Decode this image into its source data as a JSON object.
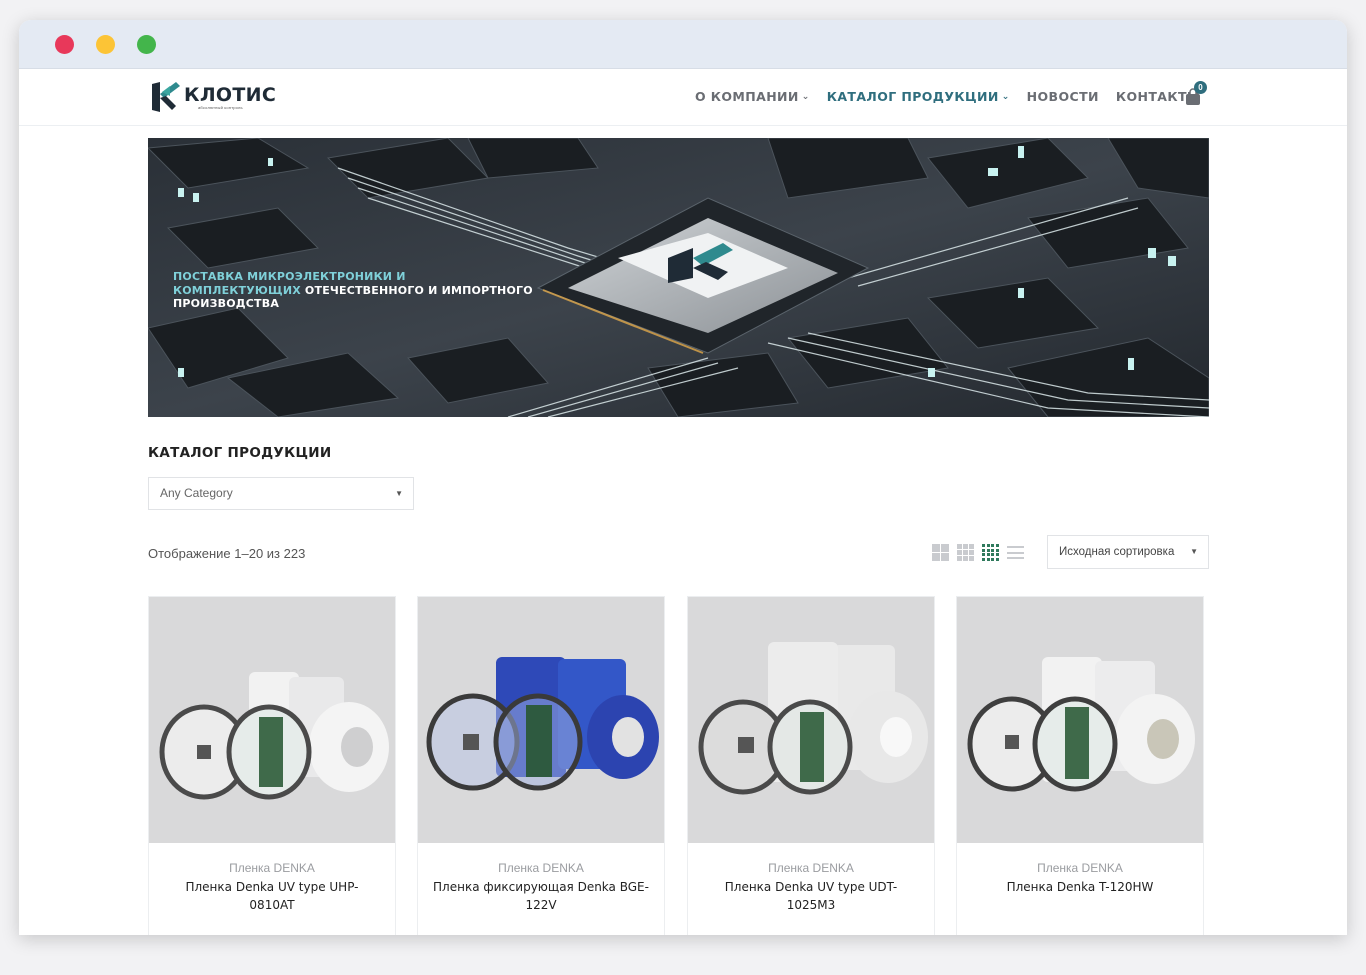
{
  "brand": {
    "name": "КЛОТИС",
    "tagline": "абсолютный контроль"
  },
  "nav": {
    "items": [
      {
        "label": "О КОМПАНИИ",
        "dropdown": true,
        "active": false
      },
      {
        "label": "КАТАЛОГ ПРОДУКЦИИ",
        "dropdown": true,
        "active": true
      },
      {
        "label": "НОВОСТИ",
        "dropdown": false,
        "active": false
      },
      {
        "label": "КОНТАКТЫ",
        "dropdown": false,
        "active": false
      }
    ],
    "cart_count": "0"
  },
  "banner": {
    "highlight_text": "ПОСТАВКА МИКРОЭЛЕКТРОНИКИ И КОМПЛЕКТУЮЩИХ",
    "main_text": " ОТЕЧЕСТВЕННОГО И ИМПОРТНОГО ПРОИЗВОДСТВА"
  },
  "catalog": {
    "title": "КАТАЛОГ ПРОДУКЦИИ",
    "category_select": "Any Category",
    "result_count": "Отображение 1–20 из 223",
    "sort_select": "Исходная сортировка",
    "active_view": "grid-4"
  },
  "products": [
    {
      "category": "Пленка DENKA",
      "name": "Пленка Denka UV type UHP-0810AT",
      "film_color": "white"
    },
    {
      "category": "Пленка DENKA",
      "name": "Пленка фиксирующая Denka BGE-122V",
      "film_color": "blue"
    },
    {
      "category": "Пленка DENKA",
      "name": "Пленка Denka UV type UDT-1025M3",
      "film_color": "clear"
    },
    {
      "category": "Пленка DENKA",
      "name": "Пленка Denka T-120HW",
      "film_color": "white"
    }
  ],
  "colors": {
    "accent": "#2f6e7e",
    "nav_text": "#6a6d73",
    "grid_active": "#2f7a5c"
  }
}
